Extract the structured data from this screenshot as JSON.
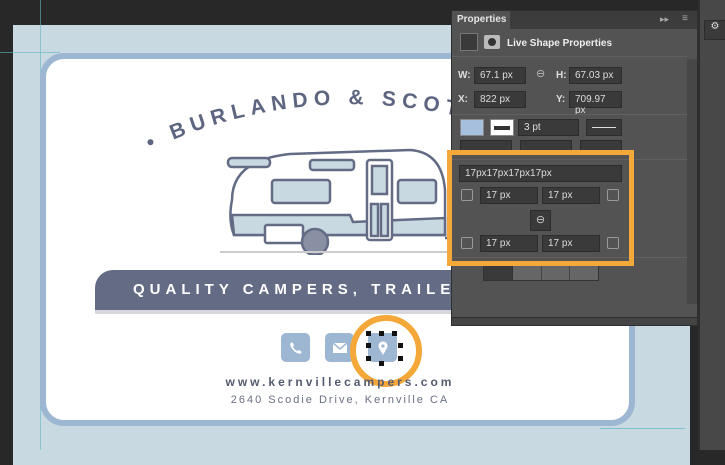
{
  "document": {
    "brand_arc": "• BURLANDO & SCOTT",
    "tagline": "QUALITY CAMPERS, TRAILERS, & RVs",
    "contact_icons": [
      "phone-icon",
      "mail-icon",
      "map-pin-icon"
    ],
    "website": "www.kernvillecampers.com",
    "address": "2640 Scodie Drive, Kernville CA",
    "colors": {
      "accent": "#9db6d2",
      "banner": "#636b85",
      "highlight": "#f5a83a"
    }
  },
  "properties": {
    "tab": "Properties",
    "header": "Live Shape Properties",
    "w_label": "W:",
    "w": "67.1 px",
    "h_label": "H:",
    "h": "67.03 px",
    "x_label": "X:",
    "x": "822 px",
    "y_label": "Y:",
    "y": "709.97 px",
    "stroke_width": "3 pt",
    "corner_summary": "17px17px17px17px",
    "corners": {
      "tl": "17 px",
      "tr": "17 px",
      "bl": "17 px",
      "br": "17 px"
    }
  }
}
